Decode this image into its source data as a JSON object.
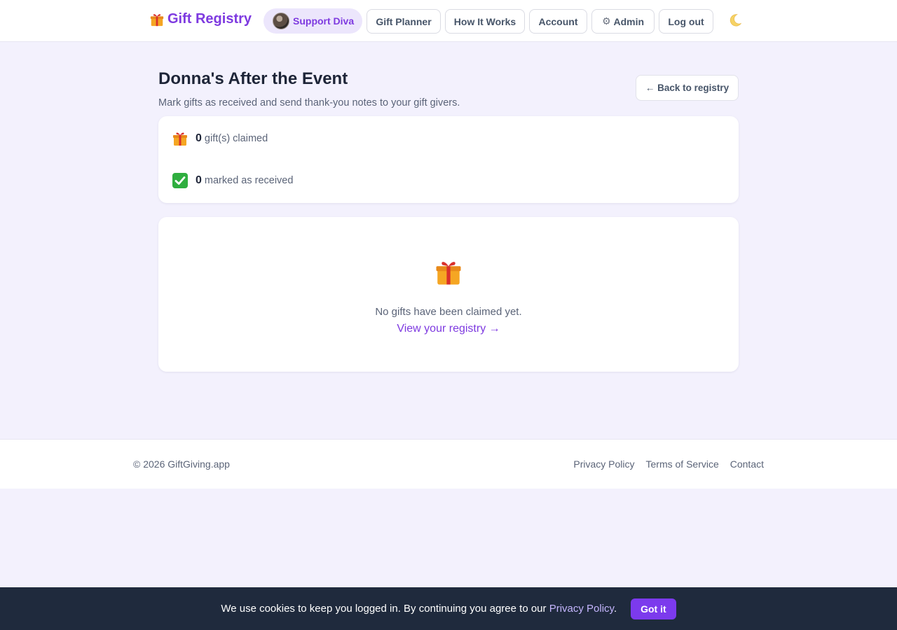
{
  "header": {
    "brand": "Gift Registry",
    "support_label": "Support Diva",
    "nav": {
      "gift_planner": "Gift Planner",
      "how_it_works": "How It Works",
      "account": "Account",
      "admin": "Admin",
      "logout": "Log out"
    },
    "theme_icon": "moon-icon"
  },
  "main": {
    "title": "Donna's After the Event",
    "subtitle": "Mark gifts as received and send thank-you notes to your gift givers.",
    "back_label": "← Back to registry",
    "stats": {
      "claimed_count": "0",
      "claimed_label": "gift(s) claimed",
      "received_count": "0",
      "received_label": "marked as received"
    },
    "empty_state": {
      "message": "No gifts have been claimed yet.",
      "link_label": "View your registry →"
    }
  },
  "footer": {
    "copyright": "© 2026 GiftGiving.app",
    "links": {
      "privacy": "Privacy Policy",
      "terms": "Terms of Service",
      "contact": "Contact"
    }
  },
  "cookie": {
    "text": "We use cookies to keep you logged in. By continuing you agree to our ",
    "link": "Privacy Policy",
    "end": ".",
    "button": "Got it"
  },
  "colors": {
    "brand": "#7e3ae0",
    "background": "#f3f1fd",
    "cookie_bar": "#1f2a3d",
    "accent_button": "#7c3aed"
  }
}
